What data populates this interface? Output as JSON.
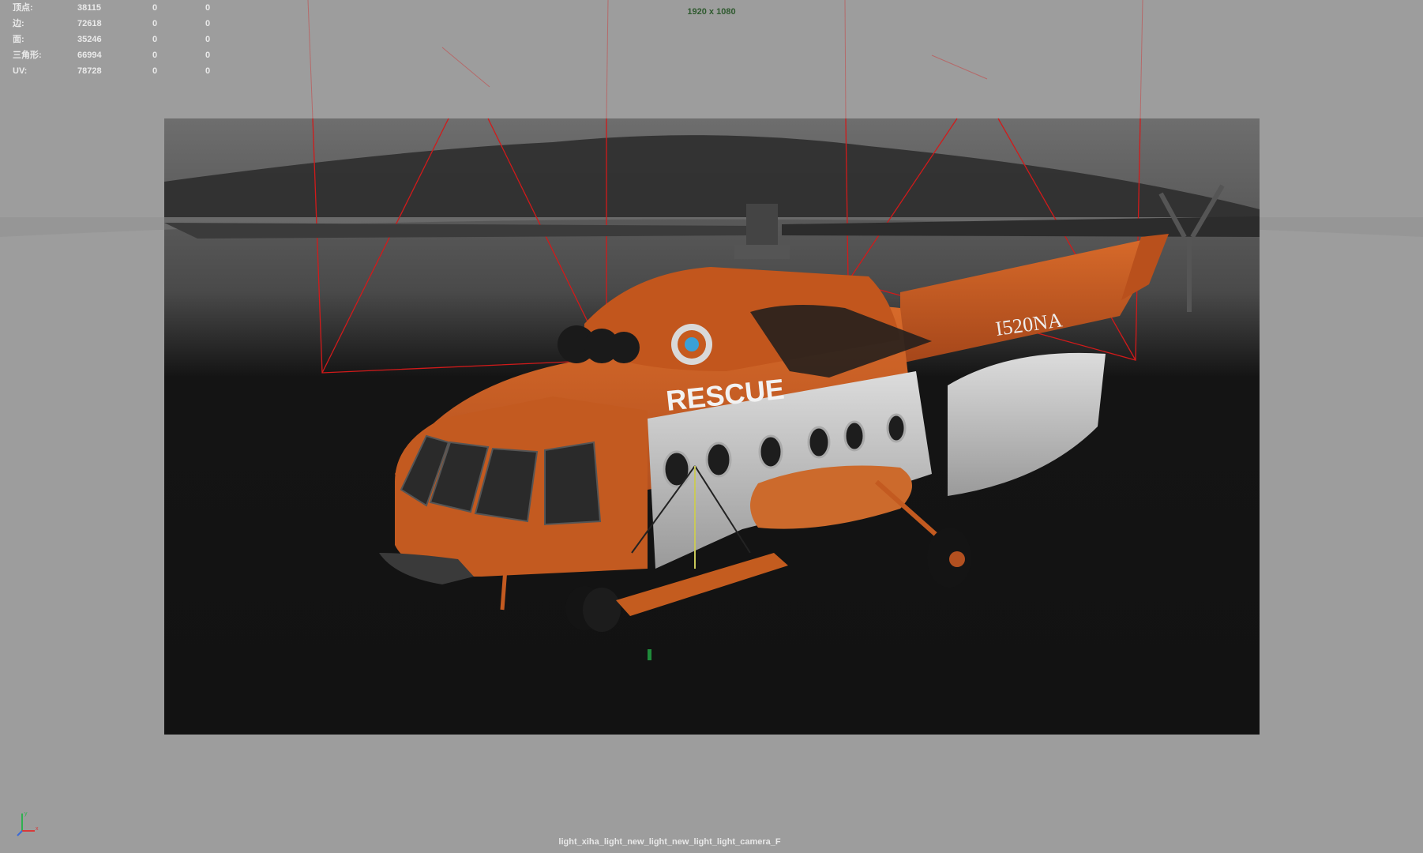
{
  "hud": {
    "rows": [
      {
        "label": "顶点:",
        "v1": "38115",
        "v2": "0",
        "v3": "0"
      },
      {
        "label": "边:",
        "v1": "72618",
        "v2": "0",
        "v3": "0"
      },
      {
        "label": "面:",
        "v1": "35246",
        "v2": "0",
        "v3": "0"
      },
      {
        "label": "三角形:",
        "v1": "66994",
        "v2": "0",
        "v3": "0"
      },
      {
        "label": "UV:",
        "v1": "78728",
        "v2": "0",
        "v3": "0"
      }
    ]
  },
  "viewport": {
    "resolution_label": "1920 x 1080",
    "camera_name": "light_xiha_light_new_light_new_light_light_camera_F",
    "helicopter": {
      "side_text": "RESCUE",
      "tail_code": "I520NA"
    },
    "colors": {
      "background": "#9d9d9d",
      "gate_top": "#6f6f6f",
      "gate_bottom": "#0f0f0f",
      "fuselage_orange": "#c65a1e",
      "fuselage_white": "#c8c8c8",
      "light_frustum": "#d81818"
    }
  },
  "axis": {
    "x_label": "x",
    "y_label": "y"
  }
}
